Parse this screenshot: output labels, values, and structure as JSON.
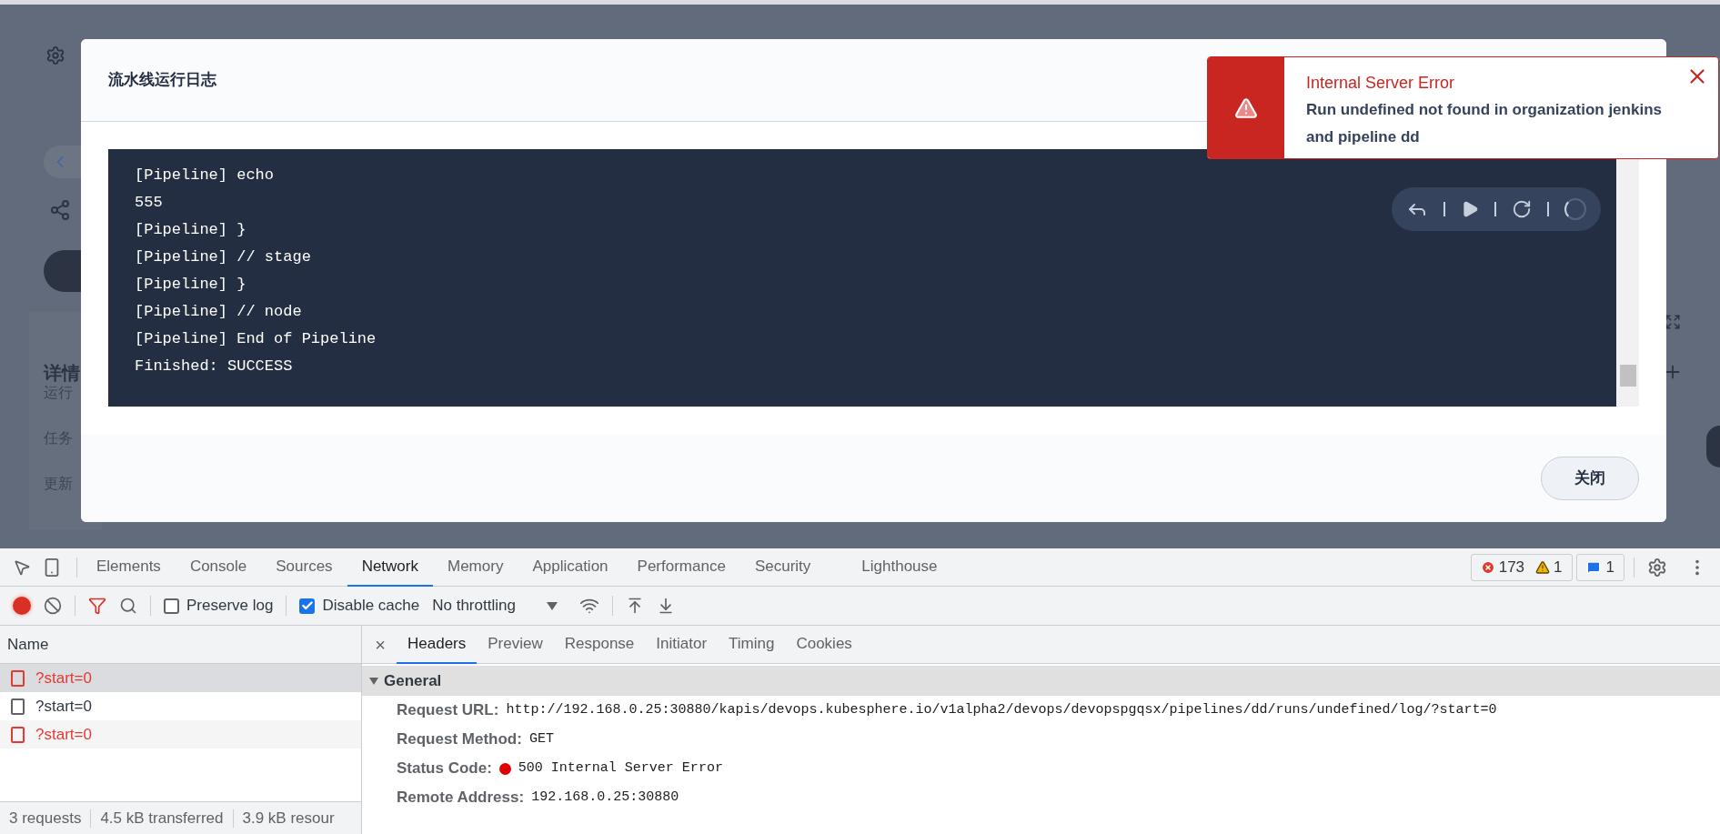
{
  "background": {
    "side_texts": [
      "详情",
      "运行",
      "任务",
      "更新"
    ]
  },
  "dialog": {
    "title": "流水线运行日志",
    "log_lines": [
      "[Pipeline] echo",
      "555",
      "[Pipeline] }",
      "[Pipeline] // stage",
      "[Pipeline] }",
      "[Pipeline] // node",
      "[Pipeline] End of Pipeline",
      "Finished: SUCCESS"
    ],
    "close_button": "关闭"
  },
  "toast": {
    "title": "Internal Server Error",
    "message": "Run undefined not found in organization jenkins and pipeline dd"
  },
  "devtools": {
    "tabs": [
      {
        "label": "Elements",
        "selected": false
      },
      {
        "label": "Console",
        "selected": false
      },
      {
        "label": "Sources",
        "selected": false
      },
      {
        "label": "Network",
        "selected": true
      },
      {
        "label": "Memory",
        "selected": false
      },
      {
        "label": "Application",
        "selected": false
      },
      {
        "label": "Performance",
        "selected": false
      },
      {
        "label": "Security",
        "selected": false
      },
      {
        "label": "Lighthouse",
        "selected": false
      }
    ],
    "issues": {
      "errors": "173",
      "warnings": "1",
      "messages": "1"
    },
    "toolbar": {
      "recording": true,
      "preserve_log": {
        "label": "Preserve log",
        "checked": false
      },
      "disable_cache": {
        "label": "Disable cache",
        "checked": true
      },
      "throttling": "No throttling"
    },
    "requests": {
      "column": "Name",
      "rows": [
        {
          "name": "?start=0",
          "selected": true,
          "failed": true
        },
        {
          "name": "?start=0",
          "selected": false,
          "failed": false
        },
        {
          "name": "?start=0",
          "selected": false,
          "failed": true
        }
      ],
      "summary": [
        "3 requests",
        "4.5 kB transferred",
        "3.9 kB resour"
      ]
    },
    "detail": {
      "close": "×",
      "tabs": [
        {
          "label": "Headers",
          "selected": true
        },
        {
          "label": "Preview",
          "selected": false
        },
        {
          "label": "Response",
          "selected": false
        },
        {
          "label": "Initiator",
          "selected": false
        },
        {
          "label": "Timing",
          "selected": false
        },
        {
          "label": "Cookies",
          "selected": false
        }
      ],
      "section": {
        "title": "General",
        "expanded": true,
        "rows": [
          {
            "label": "Request URL:",
            "value": "http://192.168.0.25:30880/kapis/devops.kubesphere.io/v1alpha2/devops/devopspgqsx/pipelines/dd/runs/undefined/log/?start=0"
          },
          {
            "label": "Request Method:",
            "value": "GET"
          },
          {
            "label": "Status Code:",
            "value": "500 Internal Server Error",
            "color": "#e00000"
          },
          {
            "label": "Remote Address:",
            "value": "192.168.0.25:30880"
          }
        ]
      }
    }
  }
}
